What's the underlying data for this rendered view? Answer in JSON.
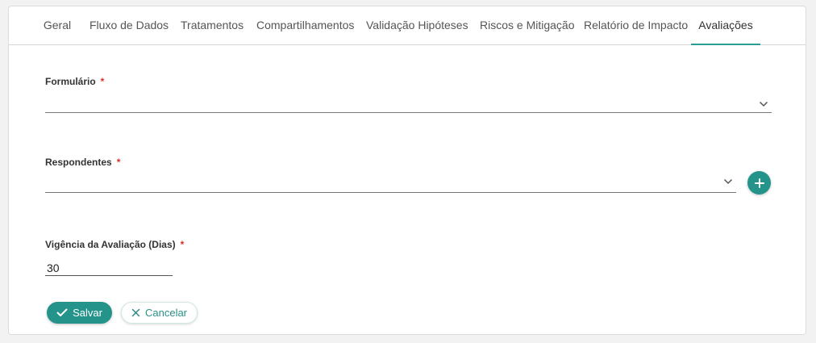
{
  "tabs": [
    {
      "label": "Geral"
    },
    {
      "label": "Fluxo de Dados"
    },
    {
      "label": "Tratamentos"
    },
    {
      "label": "Compartilhamentos"
    },
    {
      "label": "Validação Hipóteses"
    },
    {
      "label": "Riscos e Mitigação"
    },
    {
      "label": "Relatório de Impacto"
    },
    {
      "label": "Avaliações"
    }
  ],
  "active_tab": "Avaliações",
  "form": {
    "formulario": {
      "label": "Formulário",
      "required_mark": "*",
      "value": ""
    },
    "respondentes": {
      "label": "Respondentes",
      "required_mark": "*",
      "value": "",
      "add_icon": "plus-icon"
    },
    "vigencia": {
      "label": "Vigência da Avaliação (Dias)",
      "required_mark": "*",
      "value": "30"
    }
  },
  "actions": {
    "save_label": "Salvar",
    "save_icon": "check-icon",
    "cancel_label": "Cancelar",
    "cancel_icon": "close-icon"
  },
  "colors": {
    "accent": "#24938a",
    "required": "#d93025"
  }
}
